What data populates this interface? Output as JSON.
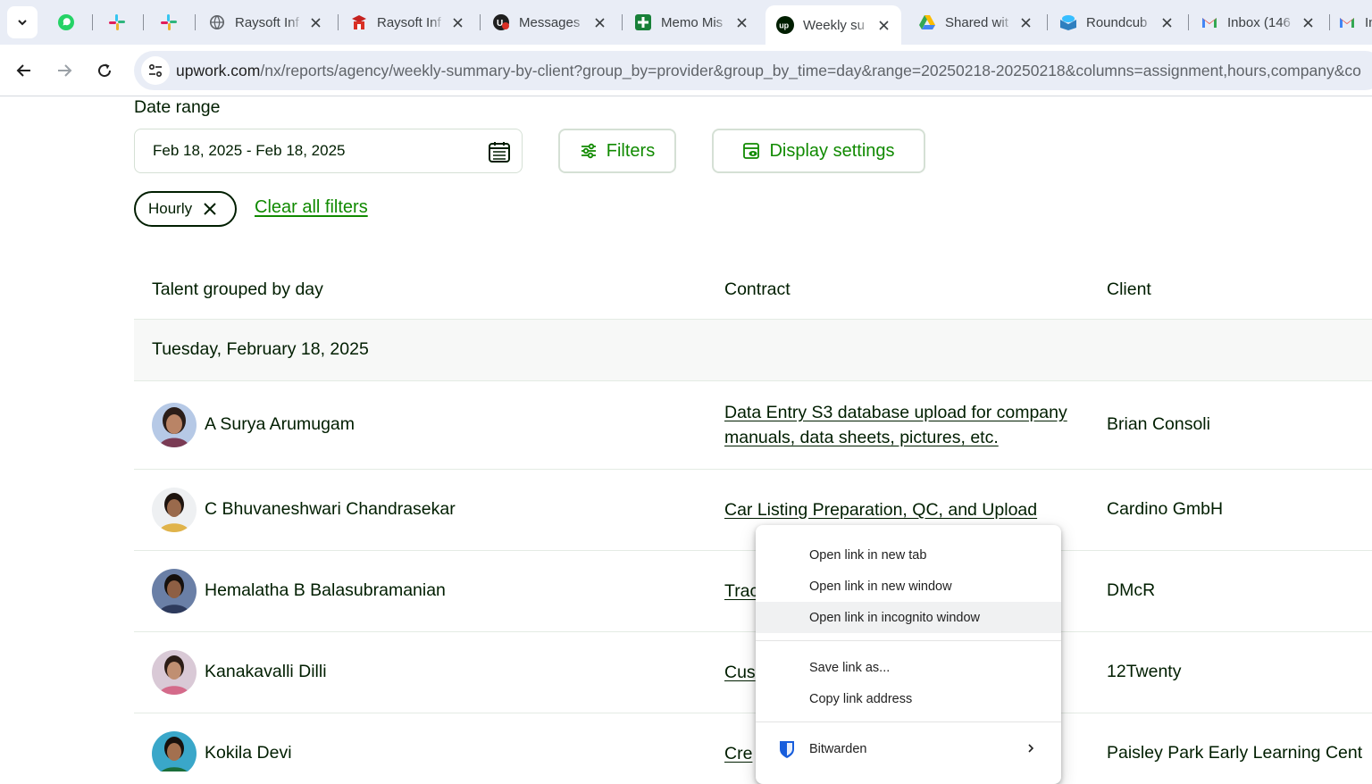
{
  "browser": {
    "tabs": [
      {
        "title": "",
        "icon": "whatsapp-icon",
        "color": "#25d366"
      },
      {
        "title": "",
        "icon": "slack-icon",
        "color": "#e01e5a"
      },
      {
        "title": "",
        "icon": "slack-icon",
        "color": "#36c5f0"
      },
      {
        "title": "Raysoft Inf",
        "icon": "globe-icon",
        "color": "#5f6368"
      },
      {
        "title": "Raysoft Inf",
        "icon": "raysoft-icon",
        "color": "#c5221f"
      },
      {
        "title": "Messages",
        "icon": "messages-icon",
        "color": "#1f1f1f"
      },
      {
        "title": "Memo Mis",
        "icon": "sheets-plus-icon",
        "color": "#188038"
      },
      {
        "title": "Weekly su",
        "icon": "upwork-icon",
        "color": "#001e00"
      },
      {
        "title": "Shared wit",
        "icon": "google-drive-icon",
        "color": "#fbbc04"
      },
      {
        "title": "Roundcub",
        "icon": "roundcube-icon",
        "color": "#37beff"
      },
      {
        "title": "Inbox (146",
        "icon": "gmail-icon",
        "color": "#ea4335"
      },
      {
        "title": "In",
        "icon": "gmail-icon",
        "color": "#ea4335"
      }
    ],
    "url_host": "upwork.com",
    "url_path": "/nx/reports/agency/weekly-summary-by-client?group_by=provider&group_by_time=day&range=20250218-20250218&columns=assignment,hours,company&co"
  },
  "filters": {
    "date_range_label": "Date range",
    "date_range_value": "Feb 18, 2025 - Feb 18, 2025",
    "filters_button": "Filters",
    "display_settings_button": "Display settings",
    "active_chip": "Hourly",
    "clear_all": "Clear all filters"
  },
  "table": {
    "headers": {
      "talent": "Talent grouped by day",
      "contract": "Contract",
      "client": "Client"
    },
    "group_label": "Tuesday, February 18, 2025",
    "rows": [
      {
        "name": "A Surya Arumugam",
        "contract": "Data Entry S3 database upload for company manuals, data sheets, pictures, etc.",
        "client": "Brian Consoli"
      },
      {
        "name": "C Bhuvaneshwari Chandrasekar",
        "contract": "Car Listing Preparation, QC, and Upload",
        "client": "Cardino GmbH"
      },
      {
        "name": "Hemalatha B Balasubramanian",
        "contract": "Trac",
        "client": "DMcR"
      },
      {
        "name": "Kanakavalli Dilli",
        "contract": "Cus",
        "client": "12Twenty"
      },
      {
        "name": "Kokila Devi",
        "contract": "Cre",
        "client": "Paisley Park Early Learning Cent"
      }
    ]
  },
  "context_menu": {
    "open_new_tab": "Open link in new tab",
    "open_new_window": "Open link in new window",
    "open_incognito": "Open link in incognito window",
    "save_link": "Save link as...",
    "copy_link": "Copy link address",
    "bitwarden": "Bitwarden"
  },
  "colors": {
    "brand_green": "#108a00",
    "text_dark": "#001e00"
  }
}
